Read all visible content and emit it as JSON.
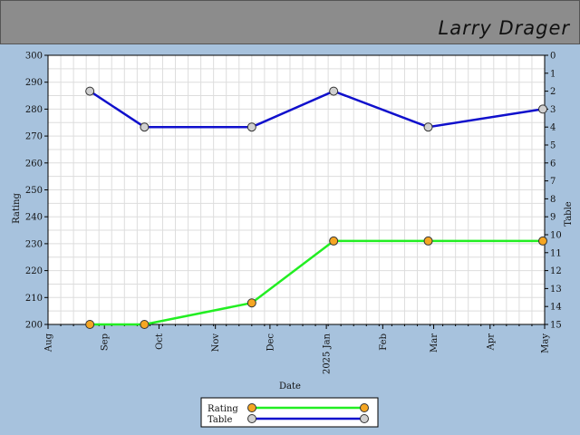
{
  "header": {
    "name": "Larry Drager"
  },
  "chart_data": {
    "type": "line",
    "xlabel": "Date",
    "ylabel_left": "Rating",
    "ylabel_right": "Table",
    "x_ticks": [
      "Aug",
      "Sep",
      "Oct",
      "Nov",
      "Dec",
      "2025 Jan",
      "Feb",
      "Mar",
      "Apr",
      "May"
    ],
    "y_left_ticks": [
      200,
      210,
      220,
      230,
      240,
      250,
      260,
      270,
      280,
      290,
      300
    ],
    "y_right_ticks": [
      0,
      1,
      2,
      3,
      4,
      5,
      6,
      7,
      8,
      9,
      10,
      11,
      12,
      13,
      14,
      15
    ],
    "ylim_left": [
      200,
      300
    ],
    "ylim_right": [
      0,
      15
    ],
    "grid": true,
    "legend_position": "bottom-center",
    "series": [
      {
        "name": "Rating",
        "axis": "left",
        "color": "#22ee22",
        "marker_color": "#f5a623",
        "points": [
          {
            "date": "2024-08-24",
            "value": 200
          },
          {
            "date": "2024-09-23",
            "value": 200
          },
          {
            "date": "2024-11-21",
            "value": 208
          },
          {
            "date": "2025-01-05",
            "value": 231
          },
          {
            "date": "2025-02-26",
            "value": 231
          },
          {
            "date": "2025-04-30",
            "value": 231
          }
        ]
      },
      {
        "name": "Table",
        "axis": "right",
        "color": "#1010cc",
        "marker_color": "#d0d0d0",
        "points": [
          {
            "date": "2024-08-24",
            "value": 2
          },
          {
            "date": "2024-09-23",
            "value": 4
          },
          {
            "date": "2024-11-21",
            "value": 4
          },
          {
            "date": "2025-01-05",
            "value": 2
          },
          {
            "date": "2025-02-26",
            "value": 4
          },
          {
            "date": "2025-04-30",
            "value": 3
          }
        ]
      }
    ]
  }
}
